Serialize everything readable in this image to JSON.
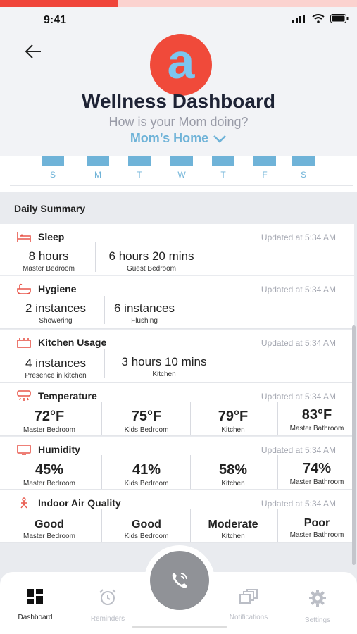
{
  "status": {
    "time": "9:41"
  },
  "header": {
    "logo_letter": "a",
    "title": "Wellness Dashboard",
    "subtitle": "How is your Mom doing?",
    "home_select": "Mom’s Home"
  },
  "week": {
    "days": [
      "S",
      "M",
      "T",
      "W",
      "T",
      "F",
      "S"
    ]
  },
  "summary": {
    "title": "Daily Summary",
    "cards": [
      {
        "name": "Sleep",
        "updated": "Updated at 5:34 AM",
        "cells": [
          {
            "value": "8 hours",
            "sub": "Master Bedroom"
          },
          {
            "value": "6 hours 20 mins",
            "sub": "Guest Bedroom"
          }
        ]
      },
      {
        "name": "Hygiene",
        "updated": "Updated at 5:34 AM",
        "cells": [
          {
            "value": "2 instances",
            "sub": "Showering"
          },
          {
            "value": "6 instances",
            "sub": "Flushing"
          }
        ]
      },
      {
        "name": "Kitchen Usage",
        "updated": "Updated at 5:34 AM",
        "cells": [
          {
            "value": "4 instances",
            "sub": "Presence in kitchen"
          },
          {
            "value": "3 hours 10 mins",
            "sub": "Kitchen"
          }
        ]
      },
      {
        "name": "Temperature",
        "updated": "Updated at 5:34 AM",
        "cells": [
          {
            "value": "72°F",
            "sub": "Master Bedroom"
          },
          {
            "value": "75°F",
            "sub": "Kids Bedroom"
          },
          {
            "value": "79°F",
            "sub": "Kitchen"
          },
          {
            "value": "83°F",
            "sub": "Master Bathroom"
          }
        ]
      },
      {
        "name": "Humidity",
        "updated": "Updated at 5:34 AM",
        "cells": [
          {
            "value": "45%",
            "sub": "Master Bedroom"
          },
          {
            "value": "41%",
            "sub": "Kids Bedroom"
          },
          {
            "value": "58%",
            "sub": "Kitchen"
          },
          {
            "value": "74%",
            "sub": "Master Bathroom"
          }
        ]
      },
      {
        "name": "Indoor Air Quality",
        "updated": "Updated at 5:34 AM",
        "cells": [
          {
            "value": "Good",
            "sub": "Master Bedroom"
          },
          {
            "value": "Good",
            "sub": "Kids Bedroom"
          },
          {
            "value": "Moderate",
            "sub": "Kitchen"
          },
          {
            "value": "Poor",
            "sub": "Master Bathroom"
          }
        ]
      }
    ]
  },
  "tabs": {
    "dashboard": "Dashboard",
    "reminders": "Reminders",
    "notifications": "Notifications",
    "settings": "Settings"
  },
  "icons": {
    "sleep": "bed-icon",
    "hygiene": "bathtub-icon",
    "kitchen": "stove-icon",
    "temperature": "thermostat-icon",
    "humidity": "display-icon",
    "air": "person-icon",
    "fab": "phone-icon"
  },
  "colors": {
    "accent": "#6fb3d8",
    "brand_red": "#f04a3a",
    "icon_red": "#e8574b"
  }
}
